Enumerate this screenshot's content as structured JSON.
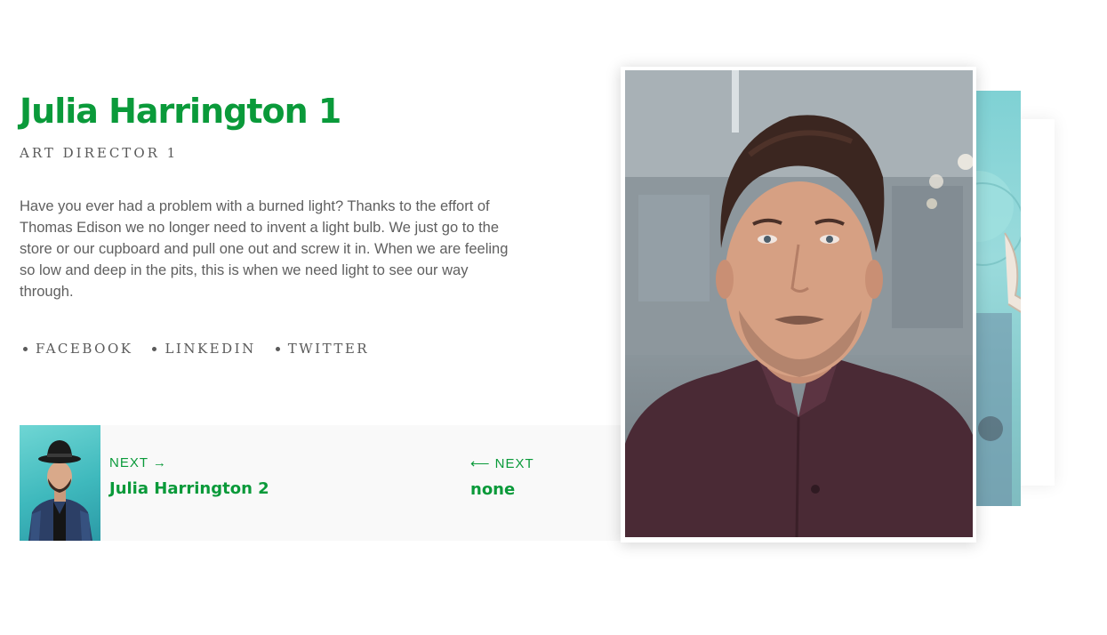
{
  "profile": {
    "name": "Julia Harrington 1",
    "role": "ART DIRECTOR 1",
    "bio": "Have you ever had a problem with a burned light? Thanks to the effort of Thomas Edison we no longer need to invent a light bulb. We just go to the store or our cupboard and pull one out and screw it in. When we are feeling so low and deep in the pits, this is when we need light to see our way through."
  },
  "social": {
    "facebook": "FACEBOOK",
    "linkedin": "LINKEDIN",
    "twitter": "TWITTER"
  },
  "nav": {
    "next_label": "NEXT →",
    "next_title": "Julia Harrington 2",
    "prev_label": "⟵  NEXT",
    "prev_title": "none"
  },
  "colors": {
    "accent": "#0a9a3a",
    "text": "#5f5f5f",
    "panel_bg": "#f9f9f9"
  },
  "icons": {
    "social_bullet": "bullet-dot-icon",
    "next_arrow": "arrow-right-icon",
    "prev_arrow": "arrow-left-icon"
  }
}
